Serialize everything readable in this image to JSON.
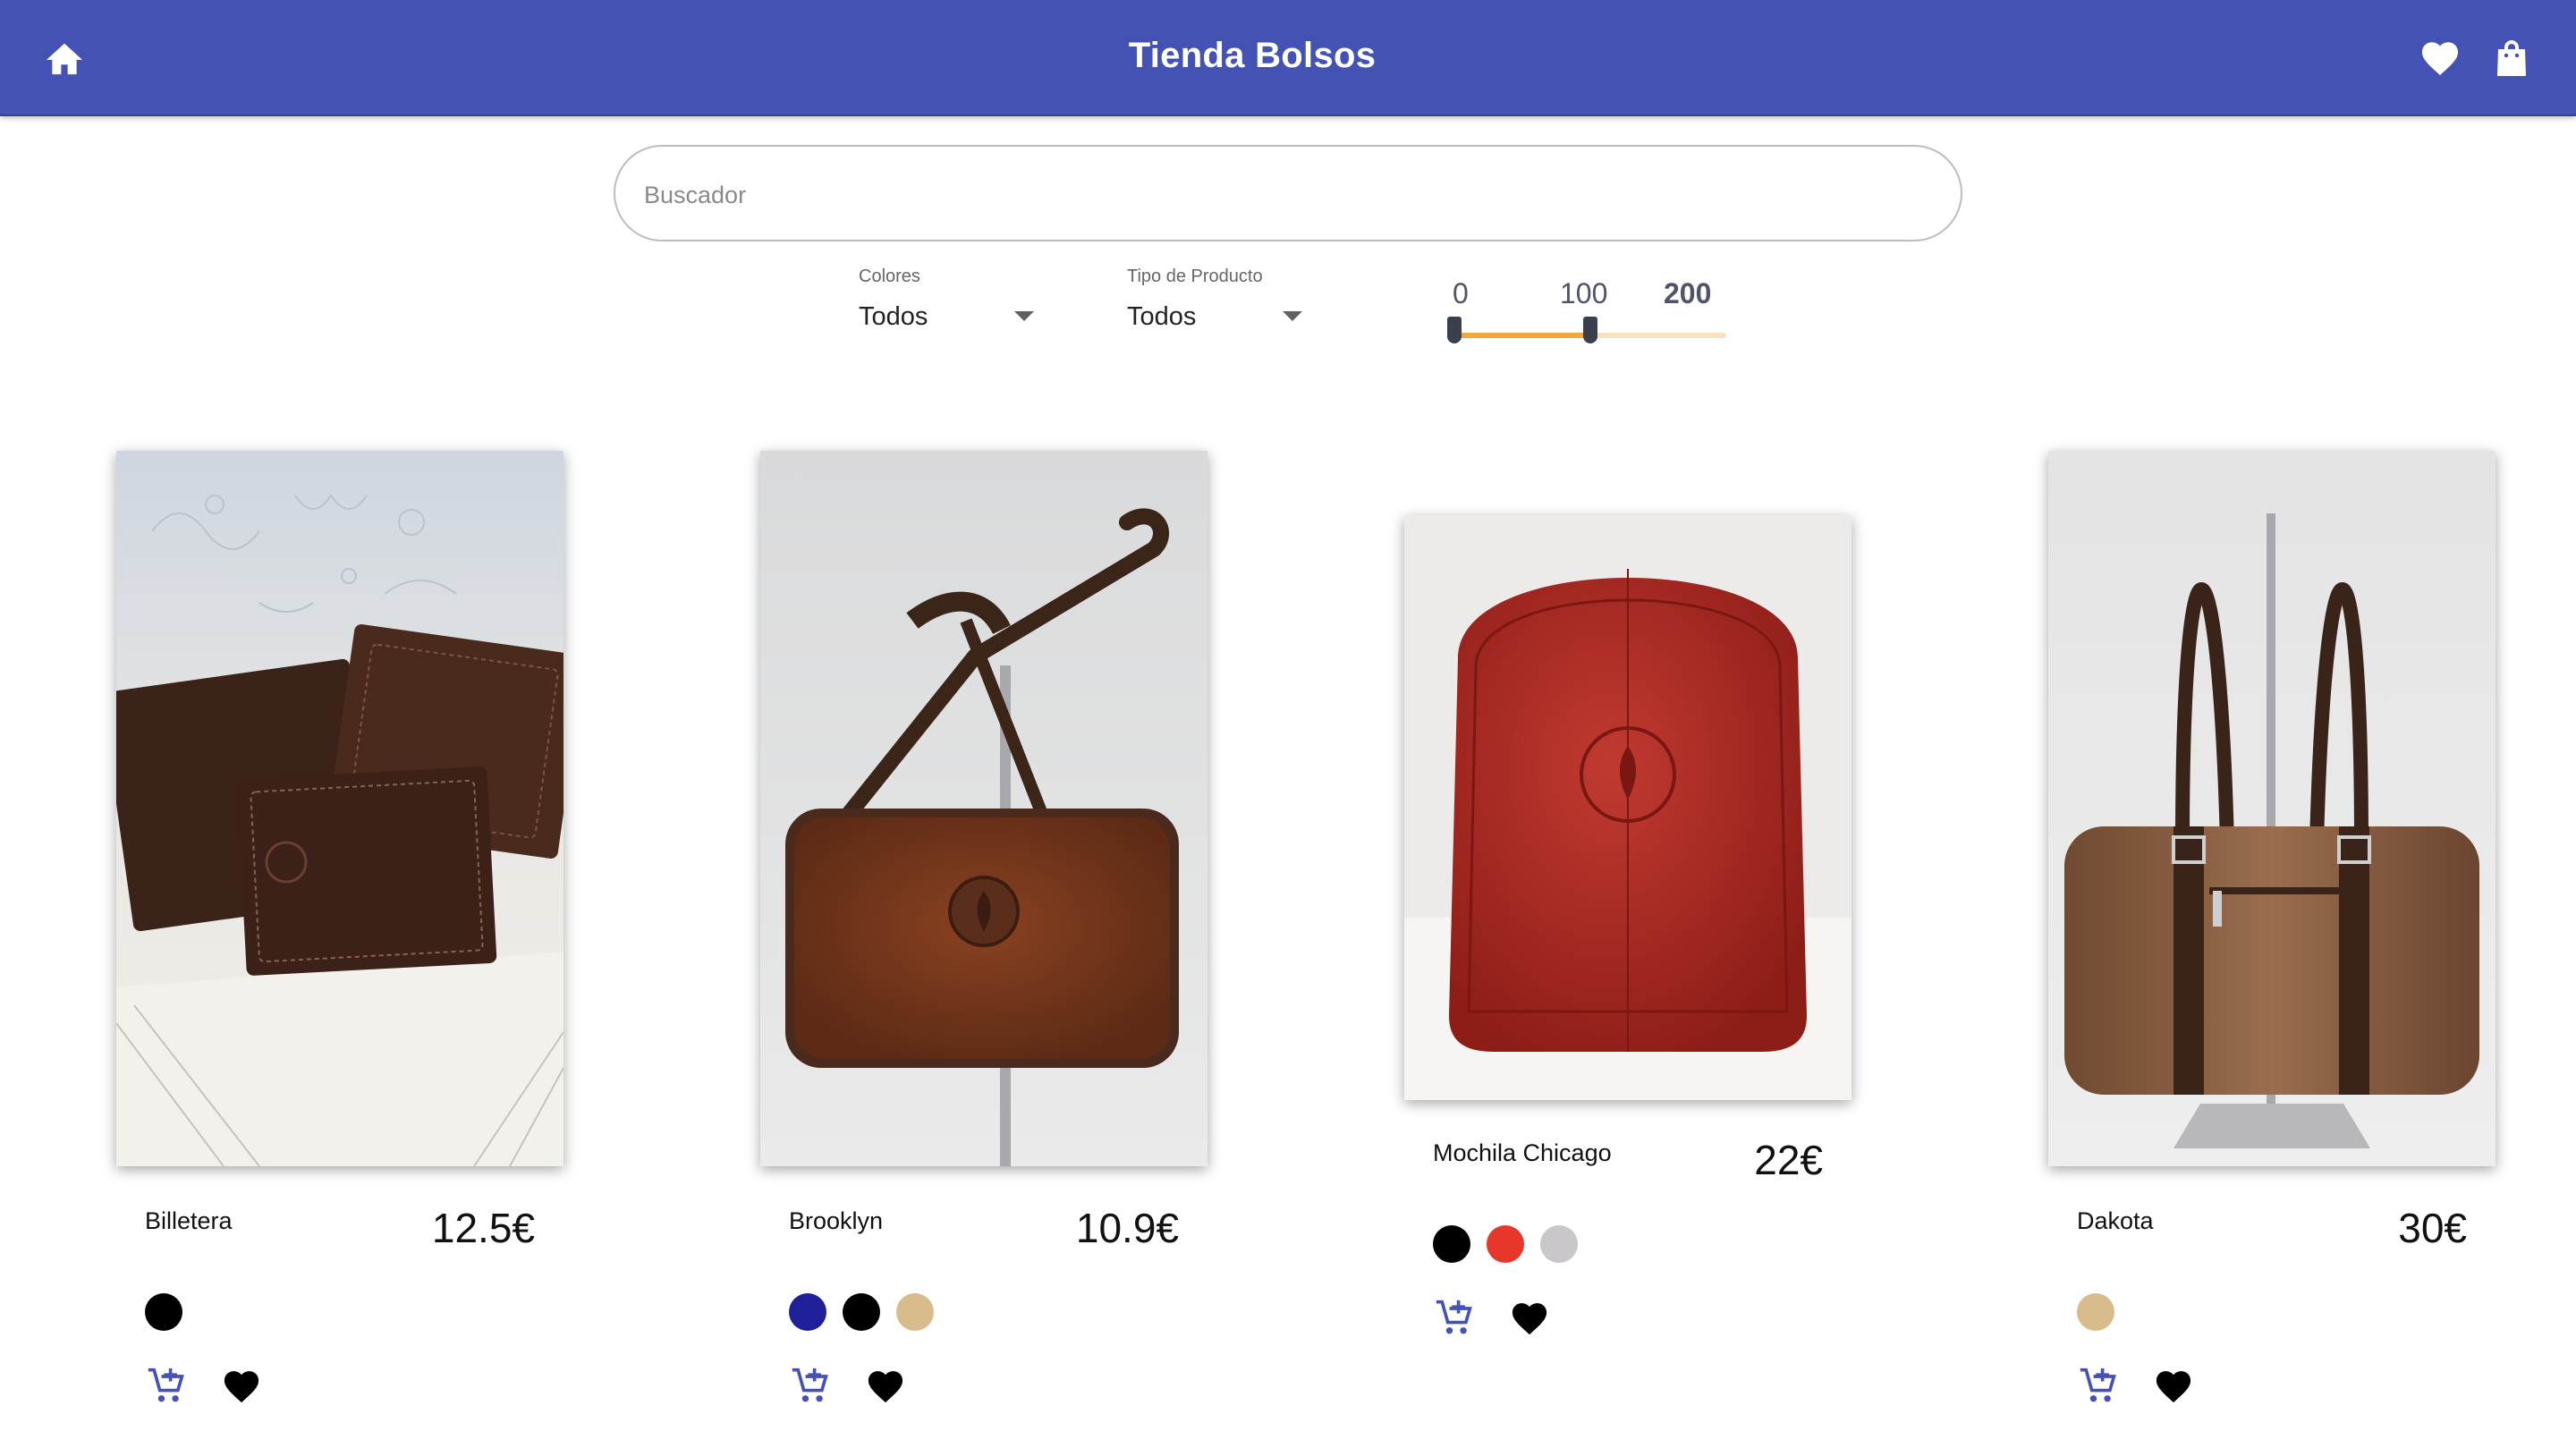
{
  "header": {
    "title": "Tienda Bolsos",
    "bg": "#4452b3"
  },
  "search": {
    "placeholder": "Buscador"
  },
  "filters": {
    "colores": {
      "label": "Colores",
      "value": "Todos"
    },
    "tipo": {
      "label": "Tipo de Producto",
      "value": "Todos"
    },
    "price_range": {
      "ticks": [
        "0",
        "100",
        "200"
      ],
      "min": 0,
      "max": 200,
      "selected": [
        0,
        100
      ],
      "accent": "#f0a93a"
    }
  },
  "products": [
    {
      "name": "Billetera",
      "price": "12.5€",
      "colors": [
        "#000000"
      ]
    },
    {
      "name": "Brooklyn",
      "price": "10.9€",
      "colors": [
        "#1f1f9a",
        "#000000",
        "#d8bc8c"
      ]
    },
    {
      "name": "Mochila Chicago",
      "price": "22€",
      "colors": [
        "#000000",
        "#e8372a",
        "#c9c7c9"
      ]
    },
    {
      "name": "Dakota",
      "price": "30€",
      "colors": [
        "#d8bc8c"
      ]
    }
  ]
}
